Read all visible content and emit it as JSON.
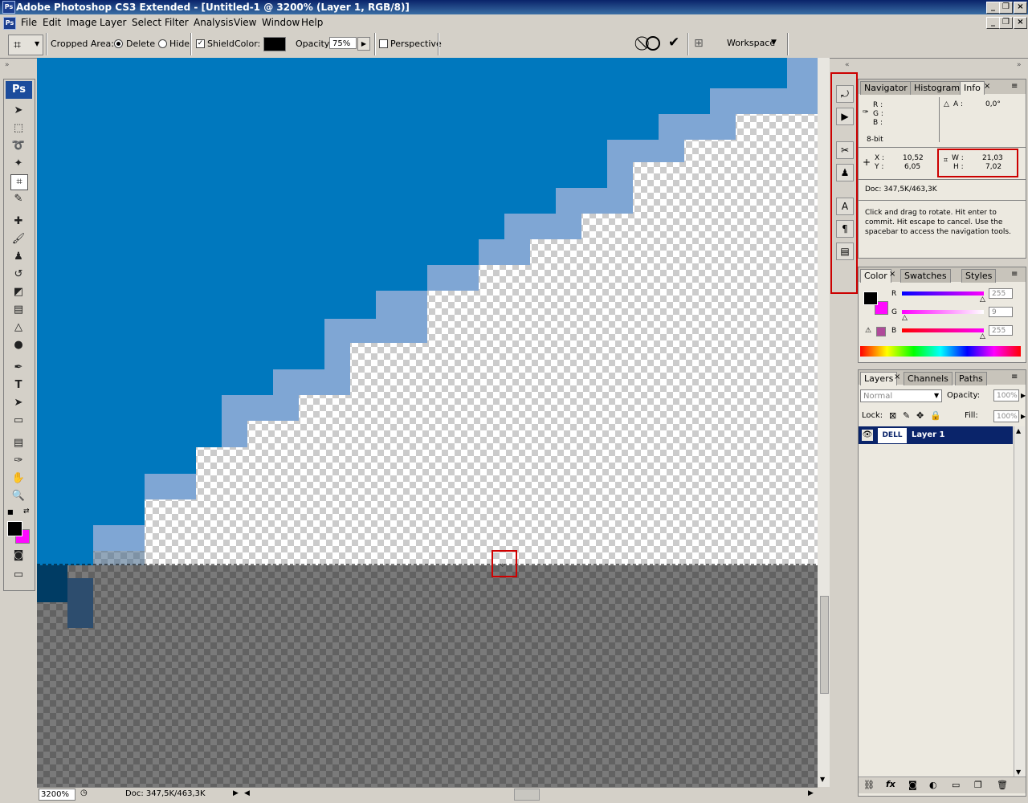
{
  "window": {
    "title": "Adobe Photoshop CS3 Extended - [Untitled-1 @ 3200% (Layer 1, RGB/8)]",
    "app_icon": "Ps"
  },
  "menu": [
    "File",
    "Edit",
    "Image",
    "Layer",
    "Select",
    "Filter",
    "Analysis",
    "View",
    "Window",
    "Help"
  ],
  "options": {
    "cropped_area_label": "Cropped Area:",
    "delete_label": "Delete",
    "hide_label": "Hide",
    "shield_label": "Shield",
    "color_label": "Color:",
    "opacity_label": "Opacity:",
    "opacity_value": "75%",
    "perspective_label": "Perspective",
    "workspace_label": "Workspace"
  },
  "toolbox": {
    "logo": "Ps"
  },
  "status": {
    "zoom": "3200%",
    "doc": "Doc: 347,5K/463,3K"
  },
  "info_panel": {
    "tabs": [
      "Navigator",
      "Histogram",
      "Info"
    ],
    "r_label": "R :",
    "g_label": "G :",
    "b_label": "B :",
    "a_label": "A :",
    "a_value": "0,0°",
    "bitdepth": "8-bit",
    "x_label": "X :",
    "x_value": "10,52",
    "y_label": "Y :",
    "y_value": "6,05",
    "w_label": "W :",
    "w_value": "21,03",
    "h_label": "H :",
    "h_value": "7,02",
    "doc": "Doc: 347,5K/463,3K",
    "hint": "Click and drag to rotate. Hit enter to commit. Hit escape to cancel. Use the spacebar to access the navigation tools."
  },
  "color_panel": {
    "tabs": [
      "Color",
      "Swatches",
      "Styles"
    ],
    "r_label": "R",
    "r_value": "255",
    "g_label": "G",
    "g_value": "9",
    "b_label": "B",
    "b_value": "255",
    "foreground": "#000000",
    "background": "#ff09ff"
  },
  "layers_panel": {
    "tabs": [
      "Layers",
      "Channels",
      "Paths"
    ],
    "blend_mode": "Normal",
    "opacity_label": "Opacity:",
    "opacity_value": "100%",
    "lock_label": "Lock:",
    "fill_label": "Fill:",
    "fill_value": "100%",
    "layer_name": "Layer 1",
    "layer_thumb": "DELL"
  },
  "colors": {
    "canvas_blue": "#0078be",
    "selection_highlight": "#0a246a"
  }
}
